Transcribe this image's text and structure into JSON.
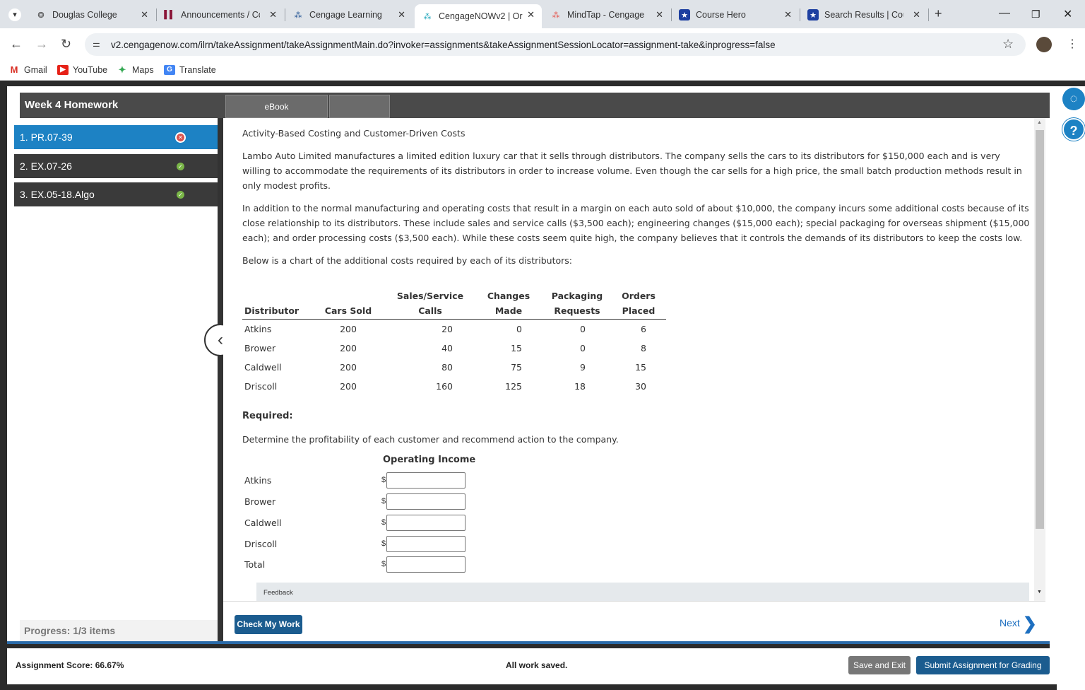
{
  "browser": {
    "tabs": [
      {
        "title": "Douglas College"
      },
      {
        "title": "Announcements / Co"
      },
      {
        "title": "Cengage Learning"
      },
      {
        "title": "CengageNOWv2 | Or"
      },
      {
        "title": "MindTap - Cengage L"
      },
      {
        "title": "Course Hero"
      },
      {
        "title": "Search Results | Cour"
      }
    ],
    "url": "v2.cengagenow.com/ilrn/takeAssignment/takeAssignmentMain.do?invoker=assignments&takeAssignmentSessionLocator=assignment-take&inprogress=false",
    "bookmarks": [
      "Gmail",
      "YouTube",
      "Maps",
      "Translate"
    ]
  },
  "assignment": {
    "title": "Week 4 Homework",
    "tab_ebook": "eBook",
    "items": [
      {
        "label": "1. PR.07-39",
        "status": "incorrect"
      },
      {
        "label": "2. EX.07-26",
        "status": "complete"
      },
      {
        "label": "3. EX.05-18.Algo",
        "status": "complete"
      }
    ],
    "progress": "Progress:  1/3 items"
  },
  "problem": {
    "heading": "Activity-Based Costing and Customer-Driven Costs",
    "para1": "Lambo Auto Limited manufactures a limited edition luxury car that it sells through distributors. The company sells the cars to its distributors for $150,000 each and is very willing to accommodate the requirements of its distributors in order to increase volume. Even though the car sells for a high price, the small batch production methods result in only modest profits.",
    "para2": "In addition to the normal manufacturing and operating costs that result in a margin on each auto sold of about $10,000, the company incurs some additional costs because of its close relationship to its distributors. These include sales and service calls ($3,500 each); engineering changes ($15,000 each); special packaging for overseas shipment ($15,000 each); and order processing costs ($3,500 each). While these costs seem quite high, the company believes that it controls the demands of its distributors to keep the costs low.",
    "para3": "Below is a chart of the additional costs required by each of its distributors:",
    "table": {
      "headers": {
        "distributor": "Distributor",
        "cars_sold": "Cars Sold",
        "sales_service_1": "Sales/Service",
        "sales_service_2": "Calls",
        "changes_1": "Changes",
        "changes_2": "Made",
        "packaging_1": "Packaging",
        "packaging_2": "Requests",
        "orders_1": "Orders",
        "orders_2": "Placed"
      },
      "rows": [
        {
          "name": "Atkins",
          "cars": "200",
          "calls": "20",
          "changes": "0",
          "packaging": "0",
          "orders": "6"
        },
        {
          "name": "Brower",
          "cars": "200",
          "calls": "40",
          "changes": "15",
          "packaging": "0",
          "orders": "8"
        },
        {
          "name": "Caldwell",
          "cars": "200",
          "calls": "80",
          "changes": "75",
          "packaging": "9",
          "orders": "15"
        },
        {
          "name": "Driscoll",
          "cars": "200",
          "calls": "160",
          "changes": "125",
          "packaging": "18",
          "orders": "30"
        }
      ]
    },
    "required_label": "Required:",
    "required_text": "Determine the profitability of each customer and recommend action to the company.",
    "oi_header": "Operating Income",
    "currency": "$",
    "oi_rows": [
      "Atkins",
      "Brower",
      "Caldwell",
      "Driscoll",
      "Total"
    ],
    "feedback": "Feedback"
  },
  "nav": {
    "check": "Check My Work",
    "next": "Next"
  },
  "footer": {
    "score": "Assignment Score:   66.67%",
    "saved": "All work saved.",
    "save_exit": "Save and Exit",
    "submit": "Submit Assignment for Grading"
  },
  "colors": {
    "active_item": "#1d82c4",
    "primary_button": "#1b5c8f",
    "status_complete": "#7ab648",
    "status_incorrect": "#d9534f"
  }
}
